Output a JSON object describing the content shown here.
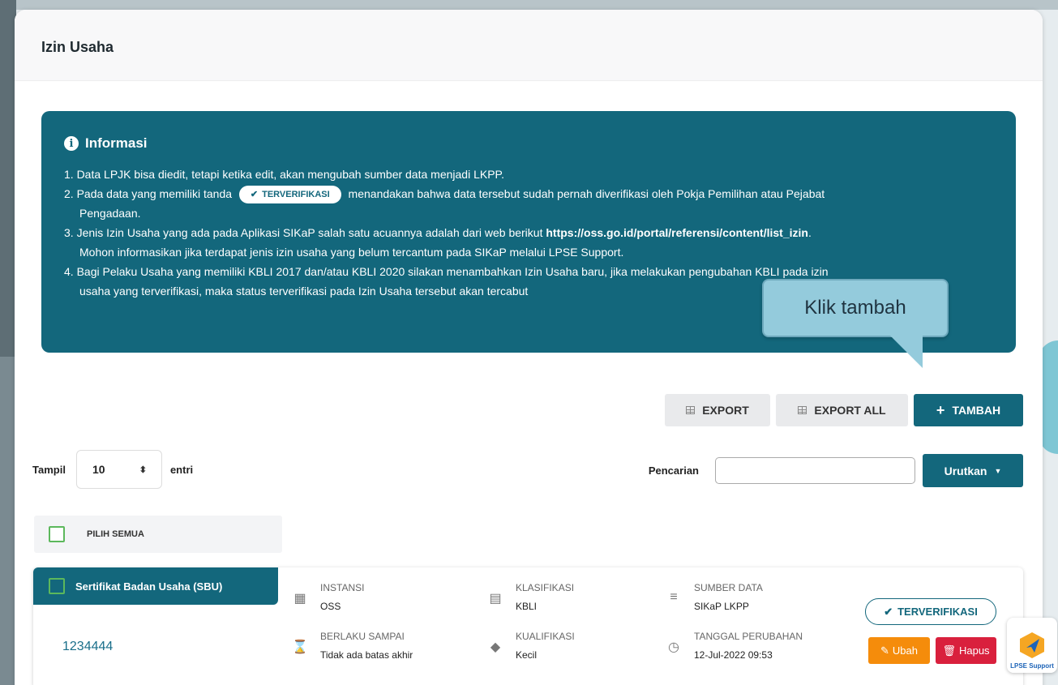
{
  "page": {
    "title": "Izin Usaha"
  },
  "info": {
    "heading": "Informasi",
    "item1": "1. Data LPJK bisa diedit, tetapi ketika edit, akan mengubah sumber data menjadi LKPP.",
    "item2_before": "2. Pada data yang memiliki tanda",
    "item2_badge": "TERVERIFIKASI",
    "item2_after": "menandakan bahwa data tersebut sudah pernah diverifikasi oleh Pokja Pemilihan atau Pejabat",
    "item2_cont": "Pengadaan.",
    "item3_before": "3. Jenis Izin Usaha yang ada pada Aplikasi SIKaP salah satu acuannya adalah dari web berikut",
    "item3_link": "https://oss.go.id/portal/referensi/content/list_izin",
    "item3_after": ".",
    "item3_cont": "Mohon informasikan jika terdapat jenis izin usaha yang belum tercantum pada SIKaP melalui LPSE Support.",
    "item4": "4. Bagi Pelaku Usaha yang memiliki KBLI 2017 dan/atau KBLI 2020 silakan menambahkan Izin Usaha baru, jika melakukan pengubahan KBLI pada izin",
    "item4_cont": "usaha yang terverifikasi, maka status terverifikasi pada Izin Usaha tersebut akan tercabut"
  },
  "callout": {
    "text": "Klik tambah"
  },
  "toolbar": {
    "export_label": "EXPORT",
    "export_all_label": "EXPORT ALL",
    "add_label": "TAMBAH",
    "add_icon": "+"
  },
  "paging": {
    "show_label": "Tampil",
    "show_value": "10",
    "entries_label": "entri"
  },
  "search": {
    "label": "Pencarian",
    "value": "",
    "sort_label": "Urutkan"
  },
  "select_all": {
    "label": "PILIH SEMUA"
  },
  "item": {
    "type": "Sertifikat Badan Usaha (SBU)",
    "id": "1234444",
    "instansi_label": "INSTANSI",
    "instansi_value": "OSS",
    "berlaku_label": "BERLAKU SAMPAI",
    "berlaku_value": "Tidak ada batas akhir",
    "klasifikasi_label": "KLASIFIKASI",
    "klasifikasi_value": "KBLI",
    "kualifikasi_label": "KUALIFIKASI",
    "kualifikasi_value": "Kecil",
    "sumber_label": "SUMBER DATA",
    "sumber_value": "SIKaP LKPP",
    "tanggal_label": "TANGGAL PERUBAHAN",
    "tanggal_value": "12-Jul-2022 09:53",
    "status_badge": "TERVERIFIKASI",
    "edit_label": "Ubah",
    "delete_label": "Hapus"
  },
  "support": {
    "label": "LPSE Support"
  },
  "colors": {
    "primary": "#13677c",
    "edit": "#f58c0b",
    "delete": "#d9203d",
    "callout": "#94cbdc"
  }
}
